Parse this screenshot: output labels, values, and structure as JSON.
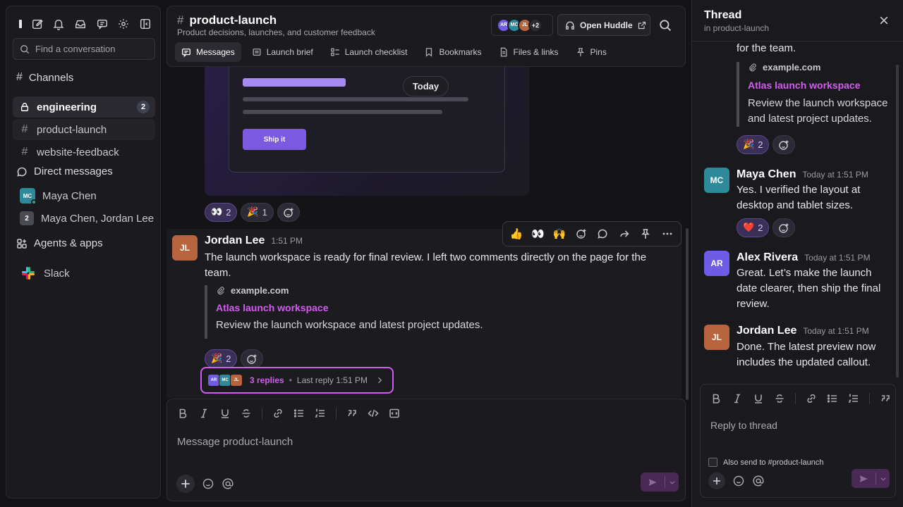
{
  "sidebar": {
    "search_placeholder": "Find a conversation",
    "channels_label": "Channels",
    "channels": [
      {
        "name": "engineering",
        "badge": "2"
      },
      {
        "name": "product-launch"
      },
      {
        "name": "website-feedback"
      }
    ],
    "dms_label": "Direct messages",
    "dms": [
      {
        "name": "Maya Chen",
        "initials": "MC"
      },
      {
        "name": "Maya Chen, Jordan Lee",
        "count": "2"
      }
    ],
    "agents_label": "Agents & apps",
    "apps": [
      {
        "name": "Slack"
      }
    ]
  },
  "header": {
    "channel_name": "product-launch",
    "description": "Product decisions, launches, and customer feedback",
    "member_avatars": [
      "AR",
      "MC",
      "JL"
    ],
    "member_more": "+2",
    "huddle_label": "Open Huddle",
    "tabs": [
      {
        "label": "Messages",
        "icon": "messages-icon",
        "active": true
      },
      {
        "label": "Launch brief",
        "icon": "document-icon"
      },
      {
        "label": "Launch checklist",
        "icon": "checklist-icon"
      },
      {
        "label": "Bookmarks",
        "icon": "bookmark-icon"
      },
      {
        "label": "Files & links",
        "icon": "file-icon"
      },
      {
        "label": "Pins",
        "icon": "pin-icon"
      }
    ]
  },
  "messages": {
    "today_label": "Today",
    "preview": {
      "button_label": "Ship it"
    },
    "prev_reactions": [
      {
        "emoji": "👀",
        "count": "2",
        "mine": true
      },
      {
        "emoji": "🎉",
        "count": "1"
      }
    ],
    "main": {
      "initials": "JL",
      "author": "Jordan Lee",
      "time": "1:51 PM",
      "text": "The launch workspace is ready for final review. I left two comments directly on the page for the team.",
      "unfurl": {
        "site": "example.com",
        "title": "Atlas launch workspace",
        "description": "Review the launch workspace and latest project updates."
      },
      "reactions": [
        {
          "emoji": "🎉",
          "count": "2",
          "mine": true
        }
      ],
      "replies": {
        "avatars": [
          "AR",
          "MC",
          "JL"
        ],
        "count": "3 replies",
        "separator": "•",
        "last_reply": "Last reply 1:51 PM"
      }
    },
    "toolbar": {
      "quick_reactions": [
        "👍",
        "👀",
        "🙌"
      ]
    }
  },
  "composer": {
    "placeholder": "Message product-launch"
  },
  "thread": {
    "title": "Thread",
    "subtitle": "in product-launch",
    "parent_tail": "for the team.",
    "parent_unfurl": {
      "site": "example.com",
      "title": "Atlas launch workspace",
      "description": "Review the launch workspace and latest project updates."
    },
    "parent_reactions": [
      {
        "emoji": "🎉",
        "count": "2",
        "mine": true
      }
    ],
    "replies": [
      {
        "initials": "MC",
        "author": "Maya Chen",
        "time": "Today at 1:51 PM",
        "text": "Yes. I verified the layout at desktop and tablet sizes.",
        "reaction": {
          "emoji": "❤️",
          "count": "2"
        }
      },
      {
        "initials": "AR",
        "author": "Alex Rivera",
        "time": "Today at 1:51 PM",
        "text": "Great. Let’s make the launch date clearer, then ship the final review."
      },
      {
        "initials": "JL",
        "author": "Jordan Lee",
        "time": "Today at 1:51 PM",
        "text": "Done. The latest preview now includes the updated callout."
      }
    ],
    "composer_placeholder": "Reply to thread",
    "also_send": "Also send to #product-launch"
  },
  "colors": {
    "accent": "#d35cf0",
    "avatar_ar": "#6e5ce6",
    "avatar_mc": "#2e8a9a",
    "avatar_jl": "#b8643f"
  }
}
